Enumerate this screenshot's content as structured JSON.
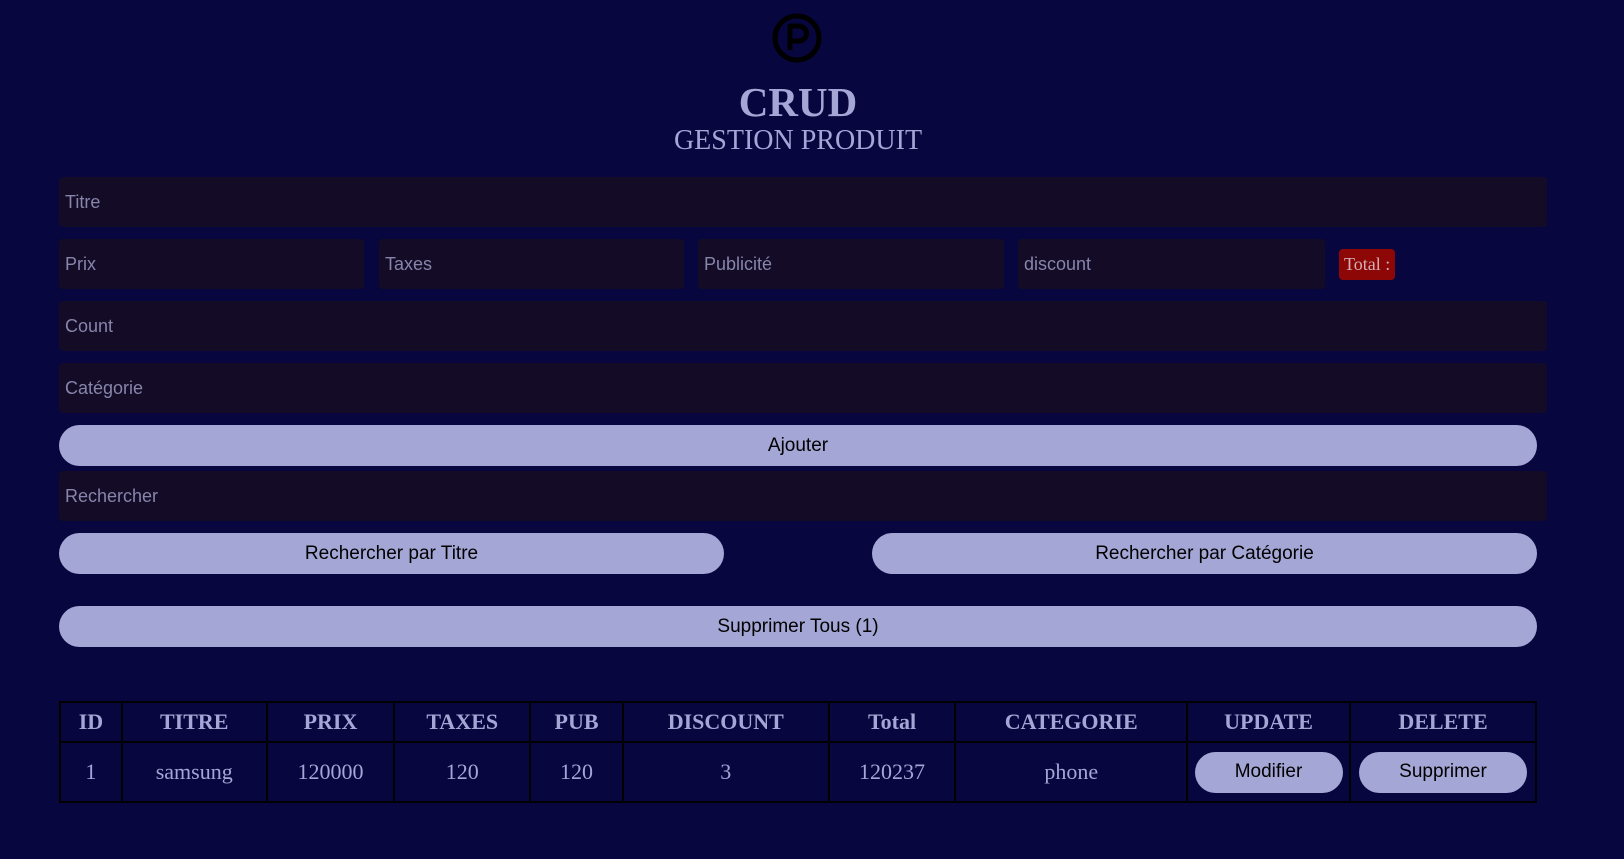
{
  "header": {
    "logo_icon": "circled-p-icon",
    "title": "CRUD",
    "subtitle": "GESTION PRODUIT"
  },
  "form": {
    "titre_placeholder": "Titre",
    "prix_placeholder": "Prix",
    "taxes_placeholder": "Taxes",
    "pub_placeholder": "Publicité",
    "discount_placeholder": "discount",
    "total_label": "Total :",
    "count_placeholder": "Count",
    "categorie_placeholder": "Catégorie",
    "ajouter_label": "Ajouter"
  },
  "search": {
    "placeholder": "Rechercher",
    "by_title_label": "Rechercher par Titre",
    "by_category_label": "Rechercher par Catégorie"
  },
  "delete_all_label": "Supprimer Tous (1)",
  "table": {
    "columns": [
      "ID",
      "TITRE",
      "PRIX",
      "TAXES",
      "PUB",
      "DISCOUNT",
      "Total",
      "CATEGORIE",
      "UPDATE",
      "DELETE"
    ],
    "rows": [
      {
        "id": "1",
        "titre": "samsung",
        "prix": "120000",
        "taxes": "120",
        "pub": "120",
        "discount": "3",
        "total": "120237",
        "categorie": "phone",
        "update_label": "Modifier",
        "delete_label": "Supprimer"
      }
    ]
  },
  "colors": {
    "background": "#08063f",
    "accent": "#a4a6d6",
    "input_bg": "#140c26",
    "total_badge": "#8d0707"
  }
}
